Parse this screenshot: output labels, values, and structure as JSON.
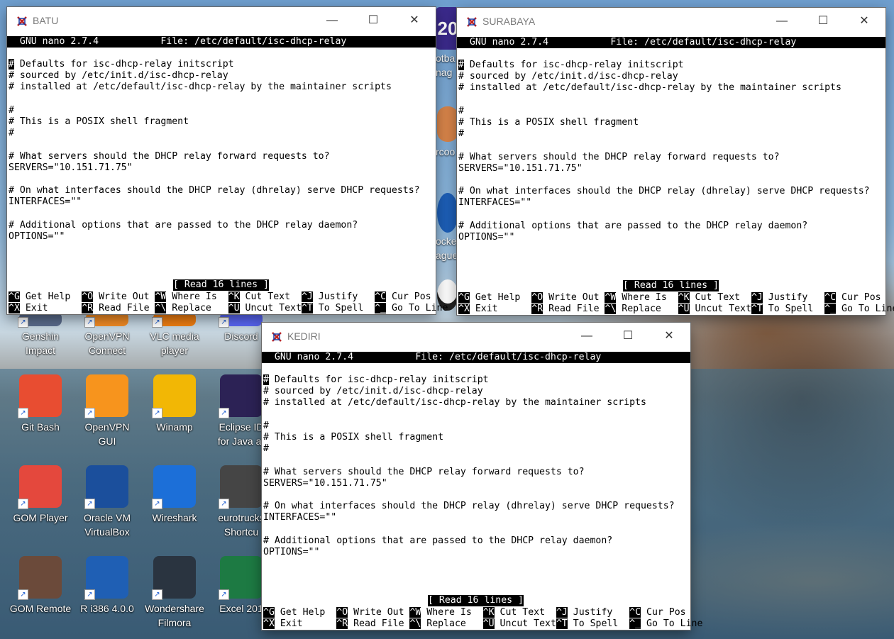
{
  "desktop_icons": [
    {
      "label": "Genshin\nImpact",
      "icon": "genshin-icon"
    },
    {
      "label": "OpenVPN\nConnect",
      "icon": "openvpn-connect-icon"
    },
    {
      "label": "VLC media\nplayer",
      "icon": "vlc-icon"
    },
    {
      "label": "Discord",
      "icon": "discord-icon"
    },
    {
      "label": "Git Bash",
      "icon": "git-bash-icon"
    },
    {
      "label": "OpenVPN\nGUI",
      "icon": "openvpn-gui-icon"
    },
    {
      "label": "Winamp",
      "icon": "winamp-icon"
    },
    {
      "label": "Eclipse ID\nfor Java ar",
      "icon": "eclipse-icon"
    },
    {
      "label": "GOM Player",
      "icon": "gom-player-icon"
    },
    {
      "label": "Oracle VM\nVirtualBox",
      "icon": "virtualbox-icon"
    },
    {
      "label": "Wireshark",
      "icon": "wireshark-icon"
    },
    {
      "label": "eurotrucks\nShortcu",
      "icon": "eurotrucks-icon"
    },
    {
      "label": "GOM Remote",
      "icon": "gom-remote-icon"
    },
    {
      "label": "R i386 4.0.0",
      "icon": "r-icon"
    },
    {
      "label": "Wondershare\nFilmora",
      "icon": "filmora-icon"
    },
    {
      "label": "Excel 201",
      "icon": "excel-icon"
    }
  ],
  "peek_labels": [
    "20",
    "otba",
    "nag",
    "rcoo",
    "ocke",
    "ague"
  ],
  "nano": {
    "header": "  GNU nano 2.7.4           File: /etc/default/isc-dhcp-relay",
    "cursor_char": "#",
    "first_line_rest": " Defaults for isc-dhcp-relay initscript",
    "body": "# sourced by /etc/init.d/isc-dhcp-relay\n# installed at /etc/default/isc-dhcp-relay by the maintainer scripts\n\n#\n# This is a POSIX shell fragment\n#\n\n# What servers should the DHCP relay forward requests to?\nSERVERS=\"10.151.71.75\"\n\n# On what interfaces should the DHCP relay (dhrelay) serve DHCP requests?\nINTERFACES=\"\"\n\n# Additional options that are passed to the DHCP relay daemon?\nOPTIONS=\"\"",
    "status": "[ Read 16 lines ]",
    "shortcuts_row1": [
      {
        "key": "^G",
        "label": " Get Help  "
      },
      {
        "key": "^O",
        "label": " Write Out "
      },
      {
        "key": "^W",
        "label": " Where Is  "
      },
      {
        "key": "^K",
        "label": " Cut Text  "
      },
      {
        "key": "^J",
        "label": " Justify   "
      },
      {
        "key": "^C",
        "label": " Cur Pos"
      }
    ],
    "shortcuts_row2": [
      {
        "key": "^X",
        "label": " Exit      "
      },
      {
        "key": "^R",
        "label": " Read File "
      },
      {
        "key": "^\\",
        "label": " Replace   "
      },
      {
        "key": "^U",
        "label": " Uncut Text"
      },
      {
        "key": "^T",
        "label": " To Spell  "
      },
      {
        "key": "^_",
        "label": " Go To Line"
      }
    ]
  },
  "windows": [
    {
      "id": "batu",
      "title": "BATU"
    },
    {
      "id": "surabaya",
      "title": "SURABAYA"
    },
    {
      "id": "kediri",
      "title": "KEDIRI"
    }
  ],
  "window_controls": {
    "minimize": "—",
    "maximize": "☐",
    "close": "✕"
  }
}
